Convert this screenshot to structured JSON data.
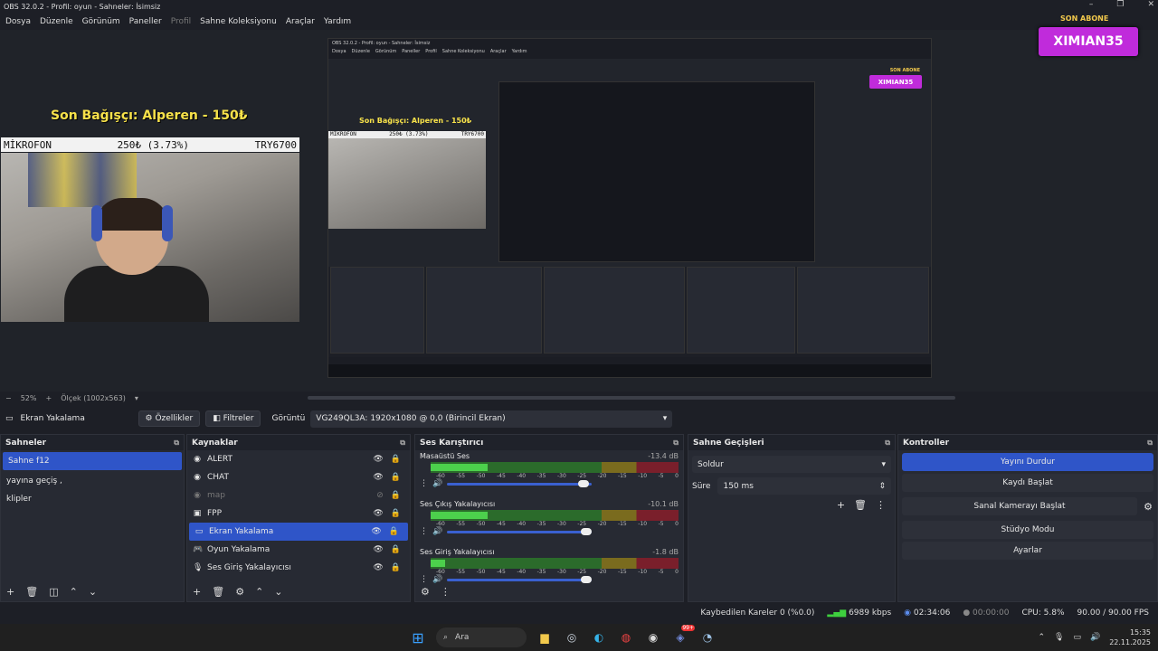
{
  "window": {
    "title": "OBS 32.0.2 - Profil: oyun - Sahneler: İsimsiz"
  },
  "menu": [
    {
      "label": "Dosya",
      "disabled": false
    },
    {
      "label": "Düzenle",
      "disabled": false
    },
    {
      "label": "Görünüm",
      "disabled": false
    },
    {
      "label": "Paneller",
      "disabled": false
    },
    {
      "label": "Profil",
      "disabled": true
    },
    {
      "label": "Sahne Koleksiyonu",
      "disabled": false
    },
    {
      "label": "Araçlar",
      "disabled": false
    },
    {
      "label": "Yardım",
      "disabled": false
    }
  ],
  "overlay": {
    "donation": "Son Bağışçı: Alperen - 150₺",
    "mic_label": "MİKROFON",
    "mic_value": "250₺ (3.73%)",
    "mic_total": "TRY6700",
    "subscribe_label": "SON ABONE",
    "subscriber": "XIMIAN35"
  },
  "nested": {
    "title": "OBS 32.0.2 - Profil: oyun - Sahneler: İsimsiz",
    "menu": [
      "Dosya",
      "Düzenle",
      "Görünüm",
      "Paneller",
      "Profil",
      "Sahne Koleksiyonu",
      "Araçlar",
      "Yardım"
    ]
  },
  "zoom": {
    "percent": "52%",
    "scale_label": "Ölçek (1002x563)"
  },
  "sourcebar": {
    "source_name": "Ekran Yakalama",
    "properties": "Özellikler",
    "filters": "Filtreler",
    "display_label": "Görüntü",
    "display_value": "VG249QL3A: 1920x1080 @ 0,0 (Birincil Ekran)"
  },
  "scenes": {
    "title": "Sahneler",
    "items": [
      {
        "label": "Sahne f12",
        "selected": true
      },
      {
        "label": "yayına geçiş ,",
        "selected": false
      },
      {
        "label": "klipler",
        "selected": false
      }
    ]
  },
  "sources": {
    "title": "Kaynaklar",
    "items": [
      {
        "label": "ALERT",
        "icon": "browser-icon",
        "visible": true,
        "selected": false
      },
      {
        "label": "CHAT",
        "icon": "browser-icon",
        "visible": true,
        "selected": false
      },
      {
        "label": "map",
        "icon": "browser-icon",
        "visible": false,
        "selected": false
      },
      {
        "label": "FPP",
        "icon": "camera-icon",
        "visible": true,
        "selected": false
      },
      {
        "label": "Ekran Yakalama",
        "icon": "monitor-icon",
        "visible": true,
        "selected": true
      },
      {
        "label": "Oyun Yakalama",
        "icon": "gamepad-icon",
        "visible": true,
        "selected": false
      },
      {
        "label": "Ses Giriş Yakalayıcısı",
        "icon": "mic-icon",
        "visible": true,
        "selected": false
      }
    ]
  },
  "mixer": {
    "title": "Ses Karıştırıcı",
    "ticks": [
      "-60",
      "-55",
      "-50",
      "-45",
      "-40",
      "-35",
      "-30",
      "-25",
      "-20",
      "-15",
      "-10",
      "-5",
      "0"
    ],
    "channels": [
      {
        "name": "Masaüstü Ses",
        "db": "-13.4 dB",
        "level": 0.23,
        "volume": 0.98
      },
      {
        "name": "Ses Çıkış Yakalayıcısı",
        "db": "-10.1 dB",
        "level": 0.23,
        "volume": 1.0
      },
      {
        "name": "Ses Giriş Yakalayıcısı",
        "db": "-1.8 dB",
        "level": 0.06,
        "volume": 1.0
      }
    ]
  },
  "transitions": {
    "title": "Sahne Geçişleri",
    "type": "Soldur",
    "duration_label": "Süre",
    "duration_value": "150 ms"
  },
  "controls": {
    "title": "Kontroller",
    "stop_stream": "Yayını Durdur",
    "start_recording": "Kaydı Başlat",
    "start_virtualcam": "Sanal Kamerayı Başlat",
    "studio_mode": "Stüdyo Modu",
    "settings": "Ayarlar"
  },
  "status": {
    "dropped_frames": "Kaybedilen Kareler 0 (%0.0)",
    "bitrate": "6989 kbps",
    "stream_time": "02:34:06",
    "rec_time": "00:00:00",
    "cpu": "CPU: 5.8%",
    "fps": "90.00 / 90.00 FPS"
  },
  "taskbar": {
    "search": "Ara",
    "time": "15:35",
    "date": "22.11.2025",
    "badge": "99+"
  },
  "colors": {
    "accent": "#2f55c8",
    "subscriber_bg": "#c02bdb",
    "donation_text": "#f8e24a"
  }
}
